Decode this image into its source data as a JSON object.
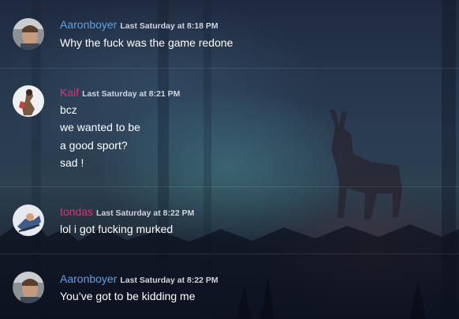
{
  "colors": {
    "user_blue": "#58a0e8",
    "user_pink": "#e2306f",
    "text": "#ffffff",
    "timestamp": "#d0d4da"
  },
  "messages": [
    {
      "username": "Aaronboyer",
      "username_color": "#58a0e8",
      "timestamp": "Last Saturday at 8:18 PM",
      "avatar": "photo-avatar-aaronboyer",
      "lines": [
        "Why the fuck was the game redone"
      ]
    },
    {
      "username": "Kaif",
      "username_color": "#e2306f",
      "timestamp": "Last Saturday at 8:21 PM",
      "avatar": "photo-avatar-kaif",
      "lines": [
        "bcz",
        "we wanted to be",
        "a good sport?",
        "sad !"
      ]
    },
    {
      "username": "tondas",
      "username_color": "#e2306f",
      "timestamp": "Last Saturday at 8:22 PM",
      "avatar": "photo-avatar-tondas",
      "lines": [
        "lol i got fucking murked"
      ]
    },
    {
      "username": "Aaronboyer",
      "username_color": "#58a0e8",
      "timestamp": "Last Saturday at 8:22 PM",
      "avatar": "photo-avatar-aaronboyer",
      "lines": [
        "You’ve got to be kidding me"
      ]
    }
  ]
}
